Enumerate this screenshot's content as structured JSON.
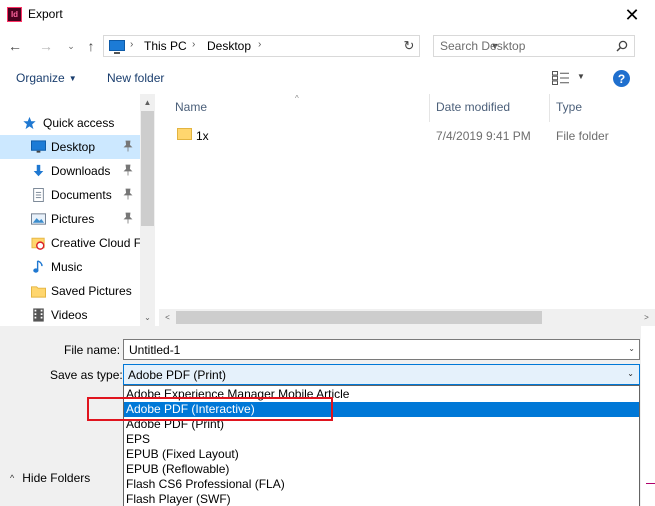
{
  "window": {
    "title": "Export",
    "app_icon_text": "Id",
    "close_glyph": "✕"
  },
  "nav": {
    "back": "←",
    "forward": "→",
    "recent": "⌄",
    "up": "↑",
    "breadcrumb": [
      "This PC",
      "Desktop"
    ],
    "breadcrumb_sep": "›",
    "refresh": "↻",
    "search_placeholder": "Search Desktop"
  },
  "commands": {
    "organize": "Organize",
    "organize_caret": "▼",
    "new_folder": "New folder",
    "view_caret": "▼",
    "help": "?"
  },
  "sidebar": {
    "items": [
      {
        "label": "Quick access",
        "icon": "star-icon",
        "pinned": false
      },
      {
        "label": "Desktop",
        "icon": "desktop-icon",
        "pinned": true,
        "selected": true
      },
      {
        "label": "Downloads",
        "icon": "download-icon",
        "pinned": true
      },
      {
        "label": "Documents",
        "icon": "documents-icon",
        "pinned": true
      },
      {
        "label": "Pictures",
        "icon": "pictures-icon",
        "pinned": true
      },
      {
        "label": "Creative Cloud F",
        "icon": "creative-cloud-icon",
        "pinned": false
      },
      {
        "label": "Music",
        "icon": "music-icon",
        "pinned": false
      },
      {
        "label": "Saved Pictures",
        "icon": "folder-icon",
        "pinned": false
      },
      {
        "label": "Videos",
        "icon": "videos-icon",
        "pinned": false
      }
    ],
    "scroll_up": "▲",
    "scroll_down": "⌄"
  },
  "filelist": {
    "columns": [
      "Name",
      "Date modified",
      "Type"
    ],
    "sort_arrow": "^",
    "rows": [
      {
        "name": "1x",
        "date": "7/4/2019 9:41 PM",
        "type": "File folder"
      }
    ],
    "scroll_left": "<",
    "scroll_right": ">"
  },
  "save": {
    "file_name_label": "File name:",
    "file_name_value": "Untitled-1",
    "save_type_label": "Save as type:",
    "save_type_value": "Adobe PDF (Print)",
    "caret": "⌄"
  },
  "type_options": [
    "Adobe Experience Manager Mobile Article",
    "Adobe PDF (Interactive)",
    "Adobe PDF (Print)",
    "EPS",
    "EPUB (Fixed Layout)",
    "EPUB (Reflowable)",
    "Flash CS6 Professional (FLA)",
    "Flash Player (SWF)"
  ],
  "highlighted_option": "Adobe PDF (Interactive)",
  "hide_folders": {
    "caret": "^",
    "label": "Hide Folders"
  },
  "colors": {
    "selection": "#0078d7",
    "nav_selected": "#cce8ff",
    "annotation": "#e0141e"
  }
}
